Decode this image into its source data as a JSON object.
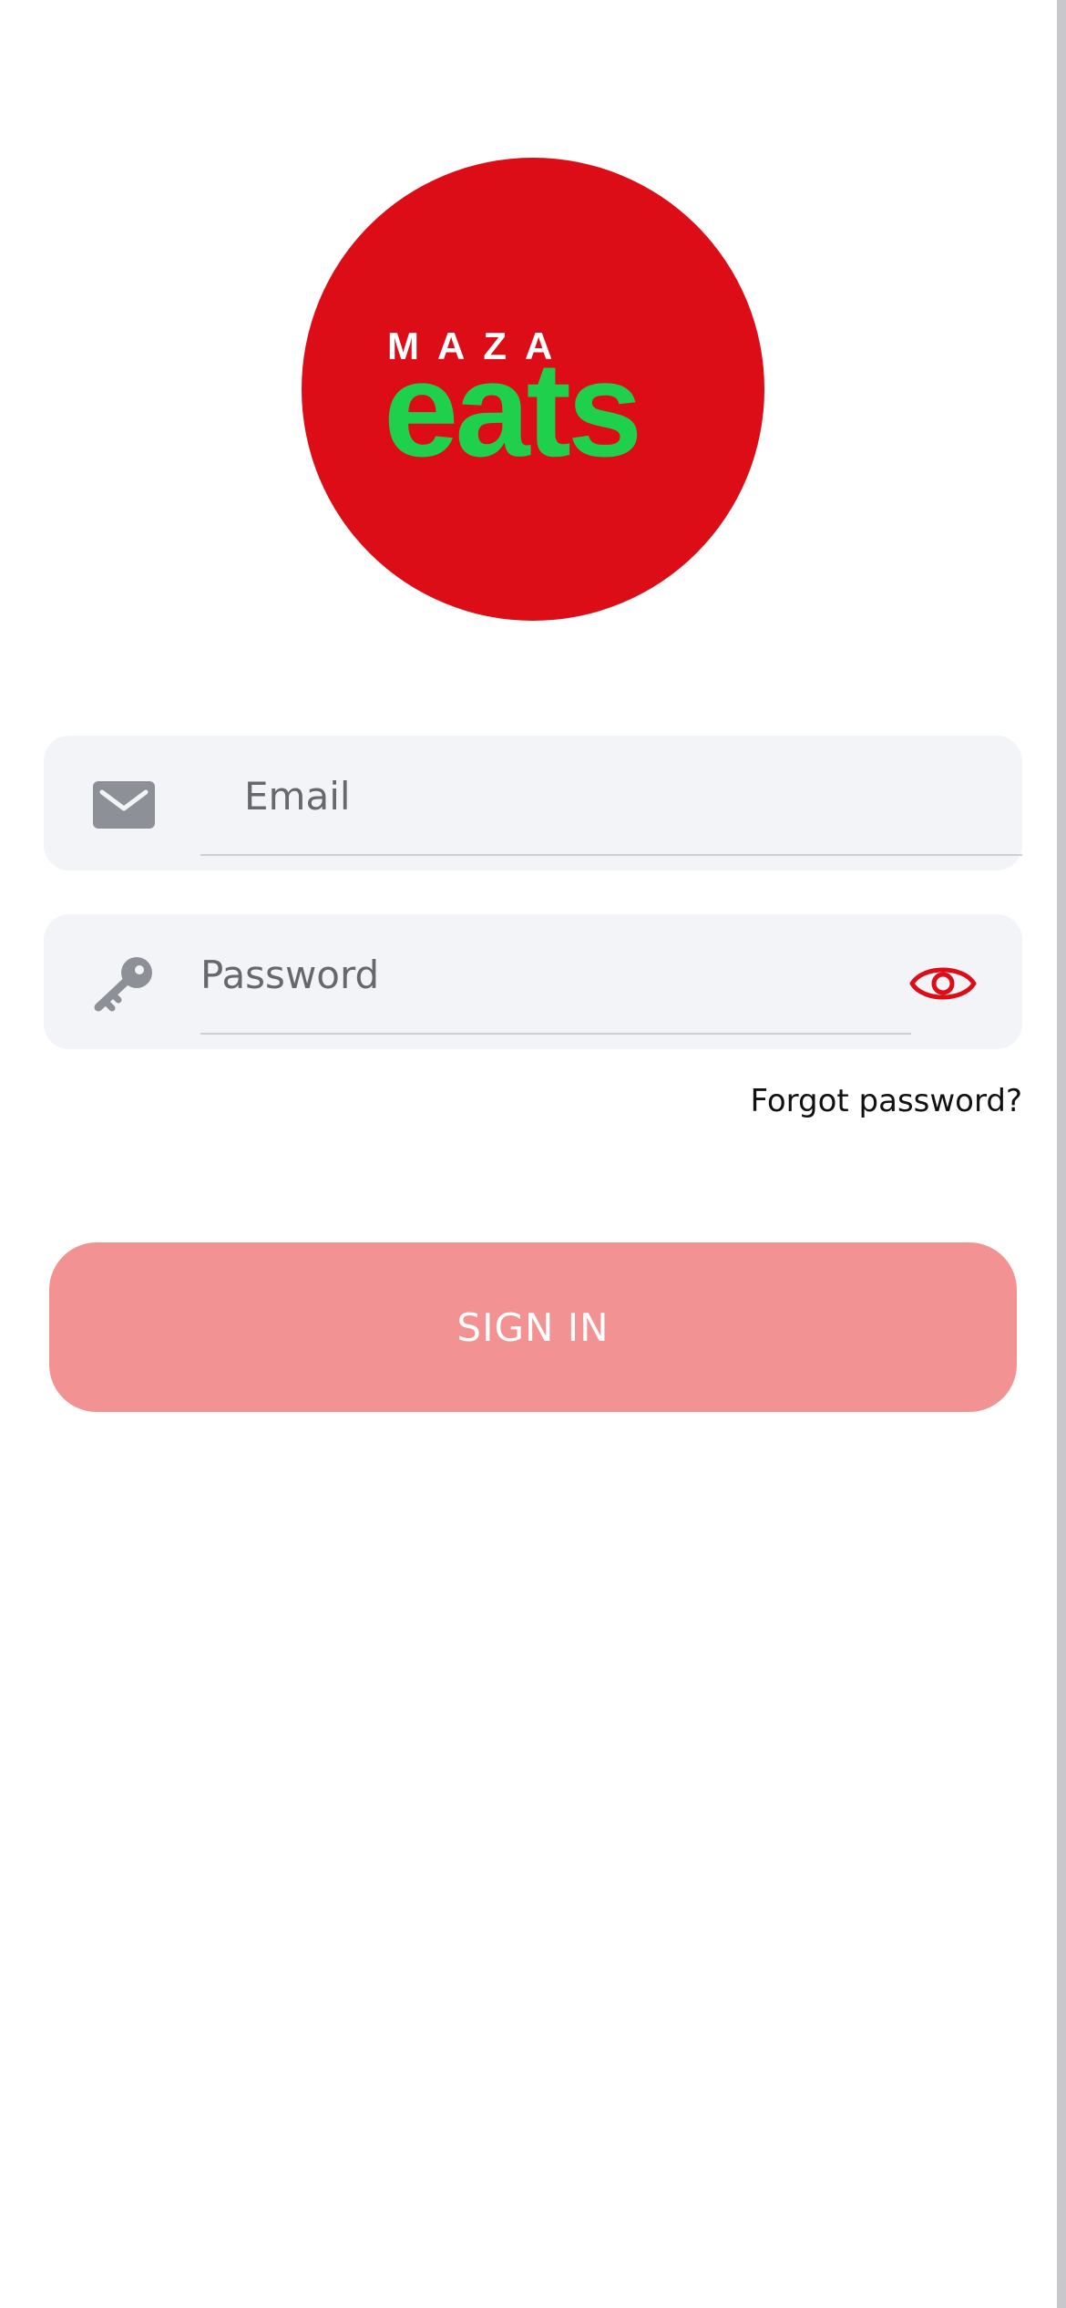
{
  "brand": {
    "word_top": "MAZA",
    "word_bottom": "eats",
    "circle_color": "#dd0d17",
    "text_top_color": "#ffffff",
    "text_bottom_color": "#1ed04c"
  },
  "form": {
    "email": {
      "value": "",
      "placeholder": "Email",
      "icon": "envelope-icon"
    },
    "password": {
      "value": "",
      "placeholder": "Password",
      "icon": "key-icon",
      "toggle_icon": "eye-icon"
    },
    "forgot_label": "Forgot password?",
    "submit_label": "SIGN IN"
  },
  "colors": {
    "field_bg": "#f3f4f8",
    "icon_gray": "#8e9098",
    "accent_red": "#dd0d17",
    "button_bg": "#f29292"
  }
}
